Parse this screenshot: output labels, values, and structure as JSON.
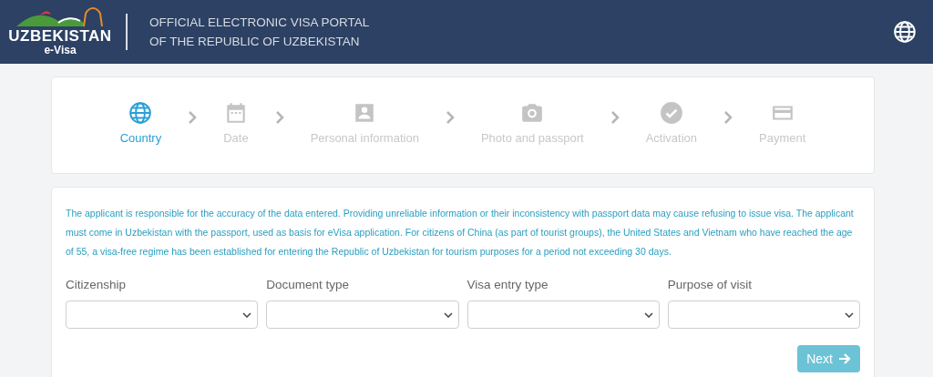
{
  "header": {
    "logo_name": "UZBEKISTAN",
    "logo_sub": "e-Visa",
    "title_line_1": "OFFICIAL ELECTRONIC VISA PORTAL",
    "title_line_2": "OF THE REPUBLIC OF UZBEKISTAN"
  },
  "steps": [
    {
      "kind": "globe",
      "label": "Country",
      "selected": true
    },
    {
      "kind": "calendar",
      "label": "Date",
      "selected": false
    },
    {
      "kind": "person",
      "label": "Personal information",
      "selected": false
    },
    {
      "kind": "camera",
      "label": "Photo and passport",
      "selected": false
    },
    {
      "kind": "check",
      "label": "Activation",
      "selected": false
    },
    {
      "kind": "card",
      "label": "Payment",
      "selected": false
    }
  ],
  "notice": "The applicant is responsible for the accuracy of the data entered. Providing unreliable information or their inconsistency with passport data may cause refusing to issue visa. The applicant must come in Uzbekistan with the passport, used as basis for eVisa application. For citizens of China (as part of tourist groups), the United States and Vietnam who have reached the age of 55, a visa-free regime has been established for entering the Republic of Uzbekistan for tourism purposes for a period not exceeding 30 days.",
  "fields": [
    {
      "label": "Citizenship"
    },
    {
      "label": "Document type"
    },
    {
      "label": "Visa entry type"
    },
    {
      "label": "Purpose of visit"
    }
  ],
  "next_button": "Next"
}
